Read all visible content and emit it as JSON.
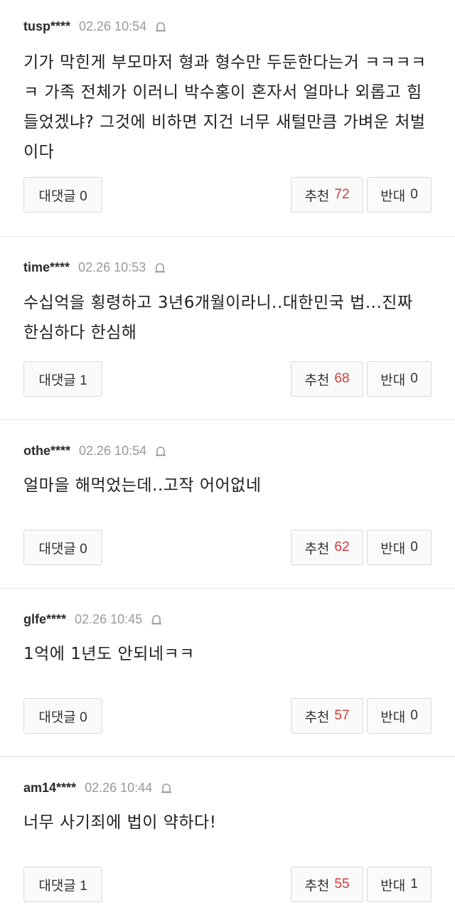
{
  "comments": [
    {
      "user": "tusp****",
      "date": "02.26 10:54",
      "text": "기가 막힌게 부모마저 형과 형수만 두둔한다는거 ㅋㅋㅋㅋㅋ 가족 전체가 이러니 박수홍이 혼자서 얼마나 외롭고 힘들었겠냐? 그것에 비하면 지건 너무 새털만큼 가벼운 처벌이다",
      "reply_label": "대댓글 0",
      "up_label": "추천",
      "up_count": "72",
      "down_label": "반대",
      "down_count": "0"
    },
    {
      "user": "time****",
      "date": "02.26 10:53",
      "text": "수십억을 횡령하고 3년6개월이라니..대한민국 법...진짜 한심하다 한심해",
      "reply_label": "대댓글 1",
      "up_label": "추천",
      "up_count": "68",
      "down_label": "반대",
      "down_count": "0"
    },
    {
      "user": "othe****",
      "date": "02.26 10:54",
      "text": "얼마을 해먹었는데..고작 어어없네",
      "reply_label": "대댓글 0",
      "up_label": "추천",
      "up_count": "62",
      "down_label": "반대",
      "down_count": "0"
    },
    {
      "user": "glfe****",
      "date": "02.26 10:45",
      "text": "1억에 1년도 안되네ㅋㅋ",
      "reply_label": "대댓글 0",
      "up_label": "추천",
      "up_count": "57",
      "down_label": "반대",
      "down_count": "0"
    },
    {
      "user": "am14****",
      "date": "02.26 10:44",
      "text": "너무 사기죄에 법이 약하다!",
      "reply_label": "대댓글 1",
      "up_label": "추천",
      "up_count": "55",
      "down_label": "반대",
      "down_count": "1"
    }
  ],
  "icons": {
    "report": "report-siren-icon"
  },
  "colors": {
    "up_count": "#d33b3b",
    "meta_date": "#9a9a9a",
    "divider": "#e6e6e6"
  }
}
